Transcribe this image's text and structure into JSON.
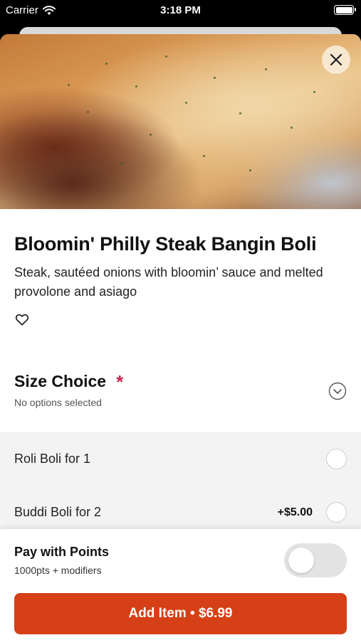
{
  "status_bar": {
    "carrier": "Carrier",
    "time": "3:18 PM",
    "icons": [
      "wifi-icon",
      "battery-icon"
    ]
  },
  "item": {
    "title": "Bloomin' Philly Steak Bangin Boli",
    "description": "Steak, sautéed onions with bloomin’ sauce and melted provolone and asiago",
    "image_alt": "photo of stuffed bread roll"
  },
  "size_choice": {
    "title": "Size Choice",
    "required_mark": "*",
    "status": "No options selected",
    "options": [
      {
        "label": "Roli Boli for 1",
        "price": ""
      },
      {
        "label": "Buddi Boli for 2",
        "price": "+$5.00"
      }
    ]
  },
  "points": {
    "title": "Pay with Points",
    "subtitle": "1000pts + modifiers",
    "enabled": false
  },
  "add_button": {
    "label": "Add Item • $6.99"
  },
  "colors": {
    "accent": "#d64016",
    "required": "#d1244a",
    "options_bg": "#f3f3f3"
  }
}
